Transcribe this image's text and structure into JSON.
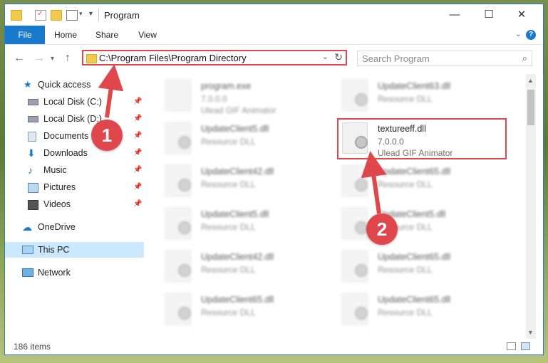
{
  "window": {
    "title": "Program",
    "min_label": "—",
    "max_label": "☐",
    "close_label": "✕"
  },
  "ribbon": {
    "tabs": [
      "File",
      "Home",
      "Share",
      "View"
    ]
  },
  "nav": {
    "address": "C:\\Program Files\\Program Directory",
    "search_placeholder": "Search Program"
  },
  "sidebar": {
    "items": [
      {
        "label": "Quick access",
        "icon": "star-icon"
      },
      {
        "label": "Local Disk (C:)",
        "icon": "drive-icon"
      },
      {
        "label": "Local Disk (D:)",
        "icon": "drive-icon"
      },
      {
        "label": "Documents",
        "icon": "documents-icon"
      },
      {
        "label": "Downloads",
        "icon": "downloads-icon"
      },
      {
        "label": "Music",
        "icon": "music-icon"
      },
      {
        "label": "Pictures",
        "icon": "pictures-icon"
      },
      {
        "label": "Videos",
        "icon": "videos-icon"
      },
      {
        "label": "OneDrive",
        "icon": "cloud-icon"
      },
      {
        "label": "This PC",
        "icon": "computer-icon"
      },
      {
        "label": "Network",
        "icon": "network-icon"
      }
    ]
  },
  "files": [
    {
      "name": "program.exe",
      "line2": "7.0.0.0",
      "line3": "Ulead GIF Animator"
    },
    {
      "name": "UpdateClient63.dll",
      "line2": "Resource DLL",
      "line3": ""
    },
    {
      "name": "UpdateClient5.dll",
      "line2": "Resource DLL",
      "line3": ""
    },
    {
      "name": "textureeff.dll",
      "line2": "7.0.0.0",
      "line3": "Ulead GIF Animator"
    },
    {
      "name": "UpdateClient42.dll",
      "line2": "Resource DLL",
      "line3": ""
    },
    {
      "name": "UpdateClient65.dll",
      "line2": "Resource DLL",
      "line3": ""
    },
    {
      "name": "UpdateClient5.dll",
      "line2": "Resource DLL",
      "line3": ""
    },
    {
      "name": "UpdateClient5.dll",
      "line2": "Resource DLL",
      "line3": ""
    },
    {
      "name": "UpdateClient42.dll",
      "line2": "Resource DLL",
      "line3": ""
    },
    {
      "name": "UpdateClient65.dll",
      "line2": "Resource DLL",
      "line3": ""
    },
    {
      "name": "UpdateClient65.dll",
      "line2": "Resource DLL",
      "line3": ""
    },
    {
      "name": "UpdateClient65.dll",
      "line2": "Resource DLL",
      "line3": ""
    }
  ],
  "status": {
    "count": "186 items"
  },
  "annotations": {
    "step1": "1",
    "step2": "2"
  },
  "colors": {
    "accent": "#1979ca",
    "highlight": "#e0474c"
  }
}
